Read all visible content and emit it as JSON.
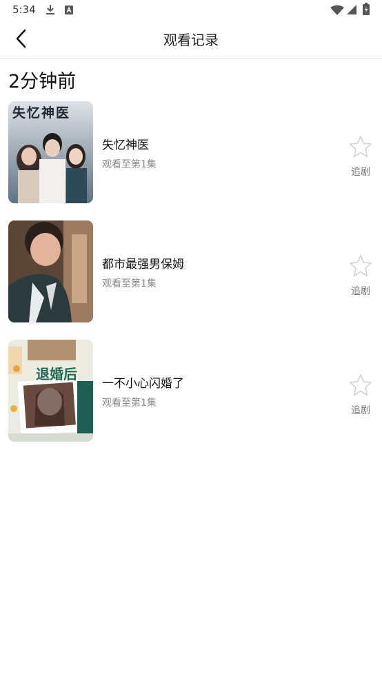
{
  "status_bar": {
    "time": "5:34",
    "left_icons": [
      "download-icon",
      "a-badge-icon"
    ],
    "right_icons": [
      "wifi-icon",
      "signal-icon",
      "battery-charging-icon"
    ]
  },
  "header": {
    "title": "观看记录",
    "back_icon": "chevron-left-icon"
  },
  "section": {
    "title": "2分钟前"
  },
  "items": [
    {
      "title": "失忆神医",
      "progress": "观看至第1集",
      "follow_label": "追剧",
      "cover_text": "失忆神医",
      "cover_colors": [
        "#7c8ea0",
        "#d6d9dd"
      ]
    },
    {
      "title": "都市最强男保姆",
      "progress": "观看至第1集",
      "follow_label": "追剧",
      "cover_text": "",
      "cover_colors": [
        "#4a3a30",
        "#8d6e58"
      ]
    },
    {
      "title": "一不小心闪婚了",
      "progress": "观看至第1集",
      "follow_label": "追剧",
      "cover_text": "退婚后",
      "cover_colors": [
        "#e9eadf",
        "#1e6b57"
      ]
    }
  ]
}
